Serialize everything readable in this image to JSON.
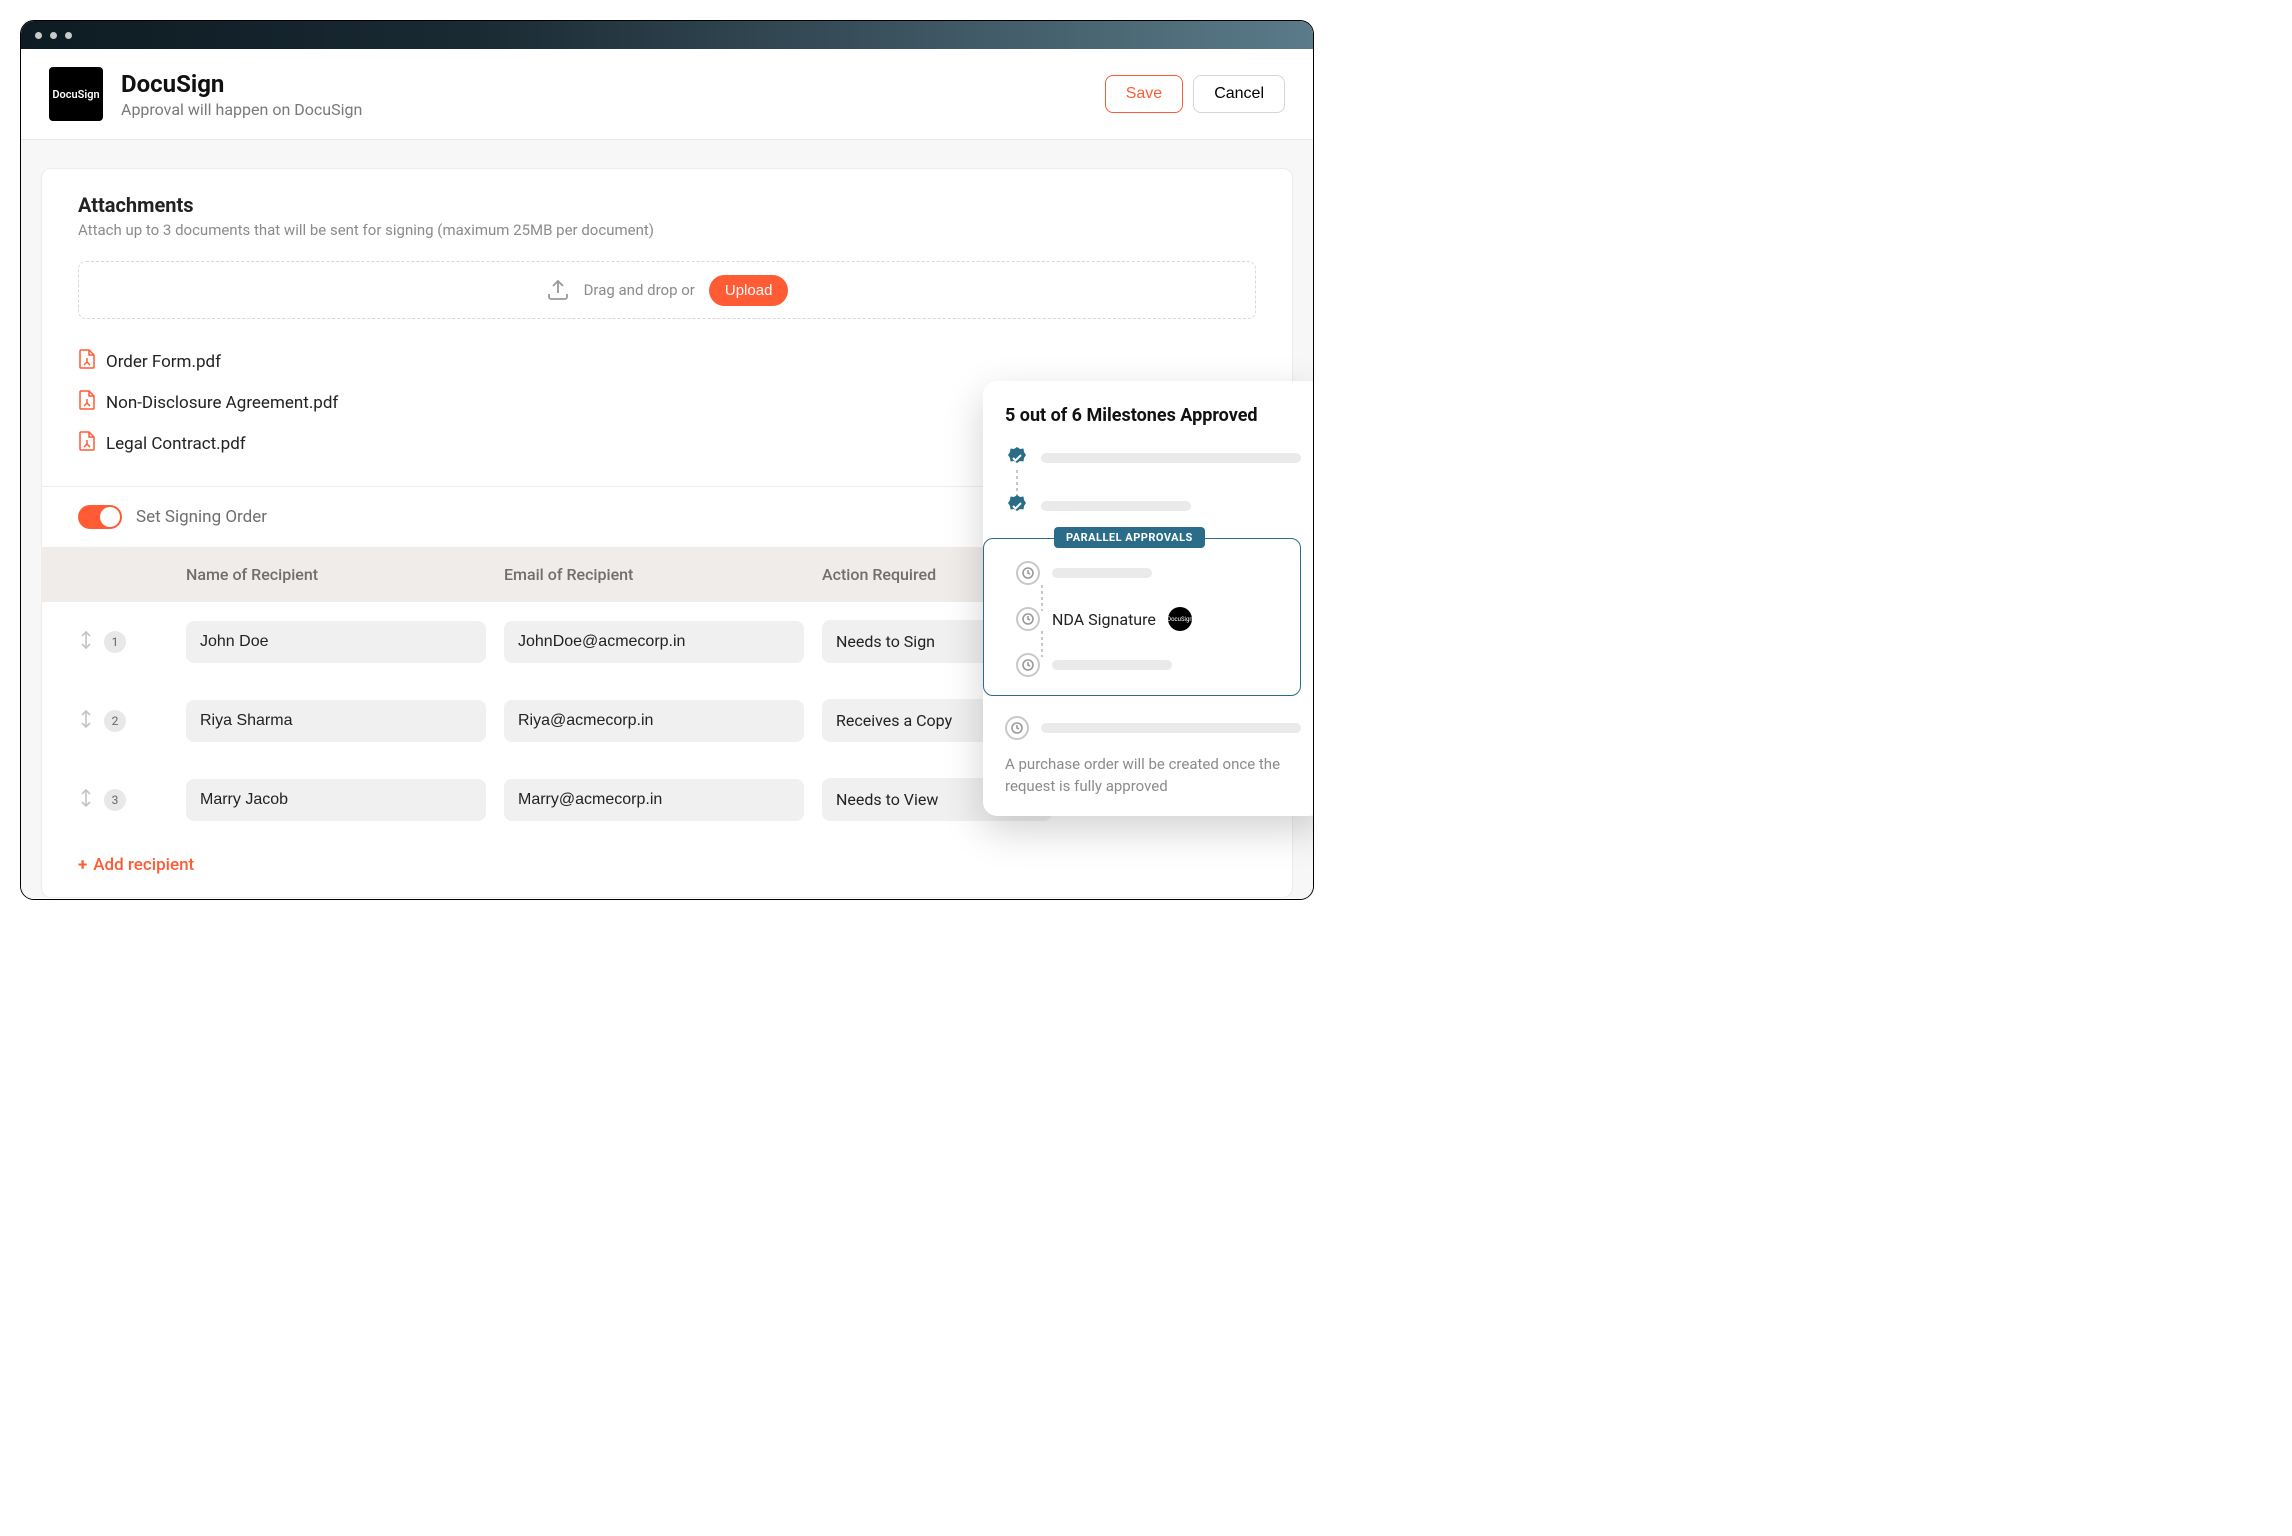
{
  "header": {
    "logo_text": "DocuSign",
    "title": "DocuSign",
    "subtitle": "Approval will happen on DocuSign",
    "save_label": "Save",
    "cancel_label": "Cancel"
  },
  "attachments": {
    "heading": "Attachments",
    "help": "Attach up to 3 documents that will be sent for signing (maximum 25MB per document)",
    "drop_text": "Drag and drop or",
    "upload_label": "Upload",
    "files": [
      {
        "name": "Order Form.pdf"
      },
      {
        "name": "Non-Disclosure Agreement.pdf"
      },
      {
        "name": "Legal Contract.pdf"
      }
    ]
  },
  "signing_order": {
    "toggle_label": "Set Signing Order",
    "enabled": true,
    "columns": {
      "name": "Name of Recipient",
      "email": "Email of Recipient",
      "action": "Action Required"
    },
    "recipients": [
      {
        "order": "1",
        "name": "John Doe",
        "email": "JohnDoe@acmecorp.in",
        "action": "Needs to Sign"
      },
      {
        "order": "2",
        "name": "Riya Sharma",
        "email": "Riya@acmecorp.in",
        "action": "Receives a Copy"
      },
      {
        "order": "3",
        "name": "Marry Jacob",
        "email": "Marry@acmecorp.in",
        "action": "Needs to View"
      }
    ],
    "add_label": "Add recipient"
  },
  "milestones": {
    "title": "5 out of 6 Milestones Approved",
    "parallel_tag": "PARALLEL APPROVALS",
    "named_item": "NDA Signature",
    "footer": "A purchase order will be created once the request is fully approved"
  }
}
